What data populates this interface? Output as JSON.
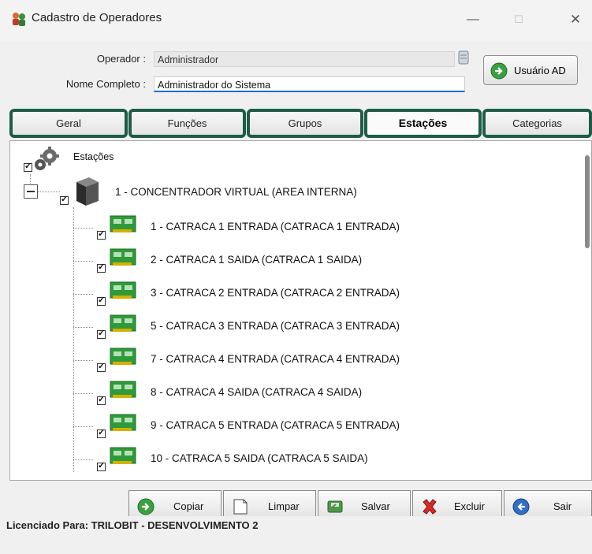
{
  "window": {
    "title": "Cadastro de Operadores",
    "minimize": "—",
    "maximize": "☐",
    "close": "✕"
  },
  "form": {
    "operador_label": "Operador :",
    "operador_value": "Administrador",
    "nome_label": "Nome Completo :",
    "nome_value": "Administrador do Sistema",
    "usuario_ad_button": "Usuário AD"
  },
  "tabs": [
    {
      "label": "Geral",
      "active": false
    },
    {
      "label": "Funções",
      "active": false
    },
    {
      "label": "Grupos",
      "active": false
    },
    {
      "label": "Estações",
      "active": true
    },
    {
      "label": "Categorias",
      "active": false
    }
  ],
  "tree": {
    "root": {
      "label": "Estações",
      "checked": true
    },
    "concentrador": {
      "label": "1 - CONCENTRADOR VIRTUAL (AREA INTERNA)",
      "checked": true,
      "expanded": true
    },
    "stations": [
      {
        "label": "1 - CATRACA 1 ENTRADA (CATRACA 1 ENTRADA)",
        "checked": true
      },
      {
        "label": "2 - CATRACA 1 SAIDA (CATRACA 1 SAIDA)",
        "checked": true
      },
      {
        "label": "3 - CATRACA 2 ENTRADA (CATRACA 2 ENTRADA)",
        "checked": true
      },
      {
        "label": "5 - CATRACA 3 ENTRADA (CATRACA 3 ENTRADA)",
        "checked": true
      },
      {
        "label": "7 - CATRACA 4 ENTRADA (CATRACA 4 ENTRADA)",
        "checked": true
      },
      {
        "label": "8 - CATRACA 4 SAIDA (CATRACA 4 SAIDA)",
        "checked": true
      },
      {
        "label": "9 - CATRACA 5 ENTRADA (CATRACA 5 ENTRADA)",
        "checked": true
      },
      {
        "label": "10 - CATRACA 5 SAIDA (CATRACA 5 SAIDA)",
        "checked": true
      }
    ]
  },
  "buttons": {
    "copiar": "Copiar",
    "limpar": "Limpar",
    "salvar": "Salvar",
    "excluir": "Excluir",
    "sair": "Sair"
  },
  "status": {
    "text": "Licenciado Para: TRILOBIT - DESENVOLVIMENTO 2"
  },
  "colors": {
    "tab_border": "#1e5c47",
    "input_focus": "#1e6fd0",
    "card_green": "#2e9b3a"
  }
}
